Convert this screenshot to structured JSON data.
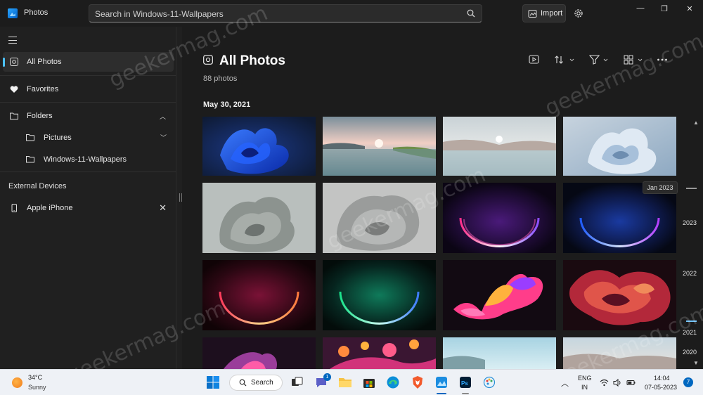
{
  "window": {
    "app_title": "Photos",
    "search_placeholder": "Search in Windows-11-Wallpapers",
    "import_label": "Import",
    "minimize": "—",
    "maximize": "❐",
    "close": "✕"
  },
  "sidebar": {
    "items": [
      {
        "label": "All Photos",
        "icon": "photos-icon",
        "active": true
      },
      {
        "label": "Favorites",
        "icon": "heart-icon"
      },
      {
        "label": "Folders",
        "icon": "folder-icon"
      }
    ],
    "folders": [
      {
        "label": "Pictures",
        "icon": "folder-icon"
      },
      {
        "label": "Windows-11-Wallpapers",
        "icon": "folder-icon"
      }
    ],
    "external_heading": "External Devices",
    "devices": [
      {
        "label": "Apple iPhone",
        "icon": "phone-icon"
      }
    ]
  },
  "main": {
    "title": "All Photos",
    "count": "88 photos",
    "date_heading": "May 30, 2021",
    "toolbar": [
      "slideshow-icon",
      "sort-icon",
      "filter-icon",
      "view-icon",
      "more-icon"
    ]
  },
  "timeline": {
    "tooltip": "Jan 2023",
    "years": [
      "2023",
      "2022",
      "2021",
      "2020"
    ],
    "up_arrow": "▲",
    "down_arrow": "▼"
  },
  "watermark": "geekermag.com",
  "taskbar": {
    "weather_temp": "34°C",
    "weather_condition": "Sunny",
    "search_label": "Search",
    "chat_badge": "1",
    "language_top": "ENG",
    "language_bottom": "IN",
    "time": "14:04",
    "date": "07-05-2023",
    "notification_count": "7"
  },
  "colors": {
    "accent": "#4cc2ff",
    "taskbar_bg": "#eef1f6",
    "window_bg": "#1c1c1c"
  }
}
